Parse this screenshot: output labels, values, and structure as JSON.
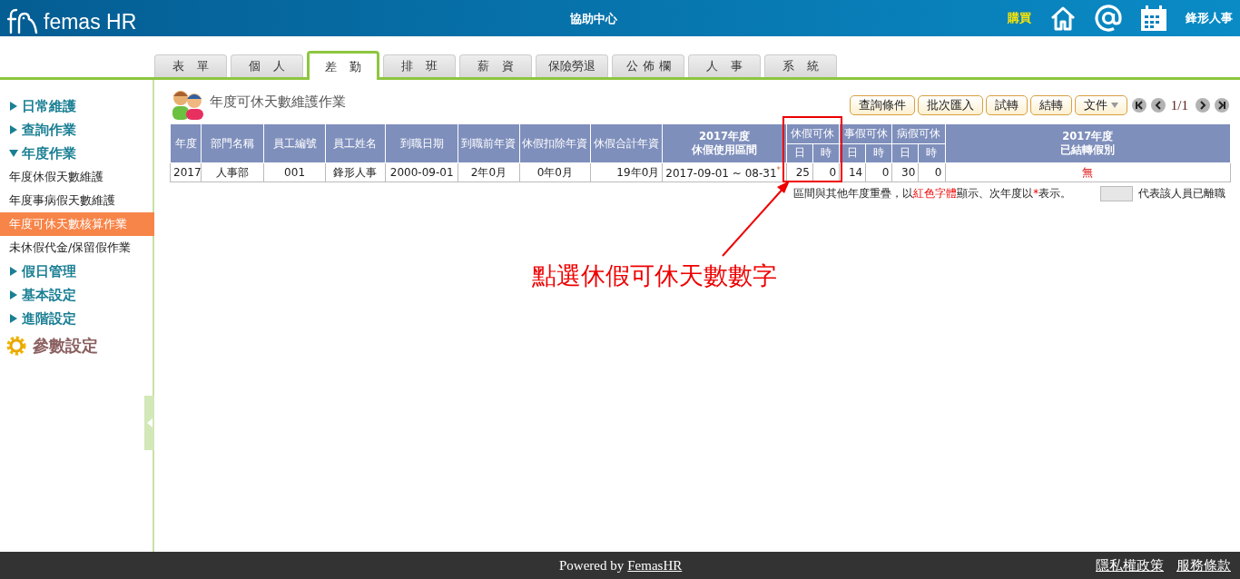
{
  "header": {
    "logo_text": "femas HR",
    "center_link": "協助中心",
    "buy_link": "購買",
    "user_name": "鋒形人事"
  },
  "tabs": [
    {
      "label": "表單",
      "selected": false
    },
    {
      "label": "個人",
      "selected": false
    },
    {
      "label": "差勤",
      "selected": true
    },
    {
      "label": "排班",
      "selected": false
    },
    {
      "label": "薪資",
      "selected": false
    },
    {
      "label": "保險勞退",
      "selected": false
    },
    {
      "label": "公佈欄",
      "selected": false
    },
    {
      "label": "人事",
      "selected": false
    },
    {
      "label": "系統",
      "selected": false
    }
  ],
  "sidebar": {
    "items": [
      {
        "kind": "group",
        "label": "日常維護",
        "expanded": false
      },
      {
        "kind": "group",
        "label": "查詢作業",
        "expanded": false
      },
      {
        "kind": "group",
        "label": "年度作業",
        "expanded": true,
        "children": [
          {
            "label": "年度休假天數維護",
            "selected": false
          },
          {
            "label": "年度事病假天數維護",
            "selected": false
          },
          {
            "label": "年度可休天數核算作業",
            "selected": true
          },
          {
            "label": "未休假代金/保留假作業",
            "selected": false
          }
        ]
      },
      {
        "kind": "group",
        "label": "假日管理",
        "expanded": false
      },
      {
        "kind": "group",
        "label": "基本設定",
        "expanded": false
      },
      {
        "kind": "group",
        "label": "進階設定",
        "expanded": false
      },
      {
        "kind": "settings",
        "label": "參數設定"
      }
    ]
  },
  "page_title": "年度可休天數維護作業",
  "toolbar": {
    "buttons": [
      {
        "label": "查詢條件",
        "kind": "plain"
      },
      {
        "label": "批次匯入",
        "kind": "plain"
      },
      {
        "label": "試轉",
        "kind": "plain"
      },
      {
        "label": "結轉",
        "kind": "plain"
      },
      {
        "label": "文件",
        "kind": "dropdown"
      }
    ],
    "pager": "1/1"
  },
  "table": {
    "columns": [
      {
        "label": "年度"
      },
      {
        "label": "部門名稱"
      },
      {
        "label": "員工編號"
      },
      {
        "label": "員工姓名"
      },
      {
        "label": "到職日期"
      },
      {
        "label": "到職前年資"
      },
      {
        "label": "休假扣除年資"
      },
      {
        "label": "休假合計年資"
      },
      {
        "label": "2017年度",
        "label_line2": "休假使用區間"
      },
      {
        "label": "休假可休",
        "colspan": 2,
        "sub": [
          "日",
          "時"
        ]
      },
      {
        "label": "事假可休",
        "colspan": 2,
        "sub": [
          "日",
          "時"
        ]
      },
      {
        "label": "病假可休",
        "colspan": 2,
        "sub": [
          "日",
          "時"
        ]
      },
      {
        "label": "2017年度",
        "label_line2": "已結轉假別"
      }
    ],
    "rows": [
      {
        "cells": [
          "2017",
          "人事部",
          "001",
          "鋒形人事",
          "2000-09-01",
          "2年0月",
          "0年0月",
          "19年0月",
          "2017-09-01 ~ 08-31",
          "25",
          "0",
          "14",
          "0",
          "30",
          "0",
          "無"
        ],
        "next_year_mark": "*"
      }
    ]
  },
  "legend": {
    "parts": [
      {
        "text": "區間與其他年度重疊，以",
        "red": false
      },
      {
        "text": "紅色字體",
        "red": true
      },
      {
        "text": "顯示、次年度以",
        "red": false
      },
      {
        "text": "*",
        "red": true
      },
      {
        "text": "表示。",
        "red": false
      }
    ],
    "resigned_note": "代表該人員已離職"
  },
  "annotation": {
    "text": "點選休假可休天數數字"
  },
  "footer": {
    "powered": "Powered by",
    "brand_link": "FemasHR",
    "links": [
      "隱私權政策",
      "服務條款"
    ]
  }
}
